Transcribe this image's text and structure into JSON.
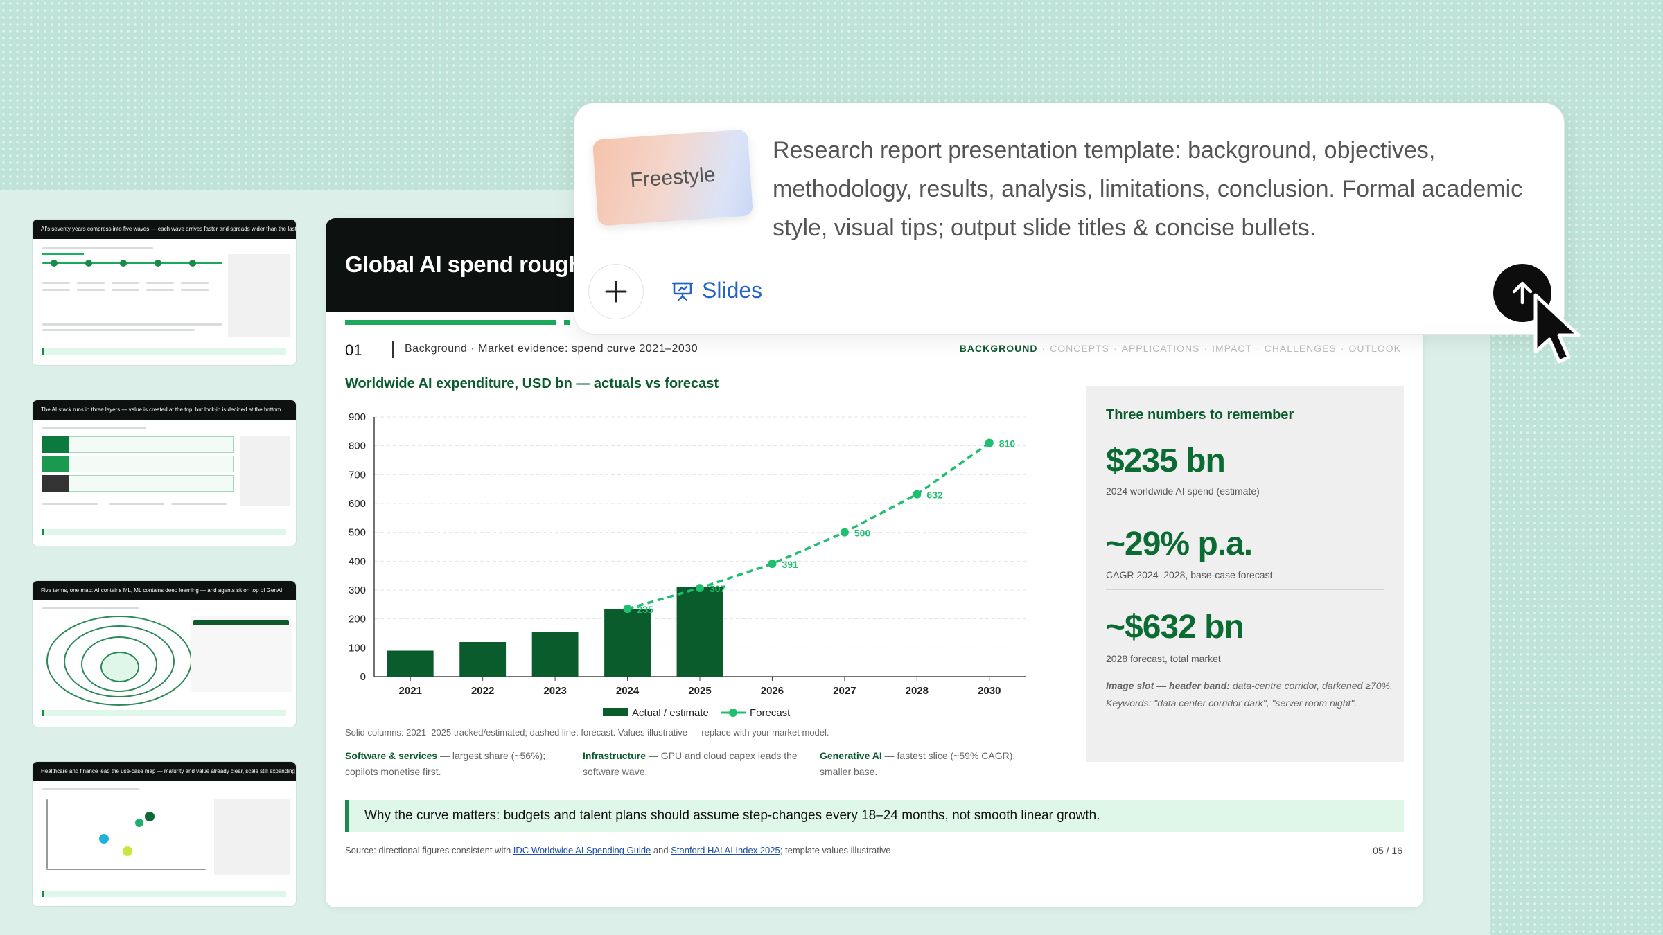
{
  "thumbnails": [
    {
      "title": "AI's seventy years compress into five waves — each wave arrives faster and spreads wider than the last"
    },
    {
      "title": "The AI stack runs in three layers — value is created at the top, but lock-in is decided at the bottom"
    },
    {
      "title": "Five terms, one map: AI contains ML, ML contains deep learning — and agents sit on top of GenAI"
    },
    {
      "title": "Healthcare and finance lead the use-case map — maturity and value already clear, scale still expanding"
    }
  ],
  "slide": {
    "header_title": "Global AI spend roughly",
    "section_number": "01",
    "breadcrumb": "Background · Market evidence: spend curve 2021–2030",
    "nav": [
      "BACKGROUND",
      "CONCEPTS",
      "APPLICATIONS",
      "IMPACT",
      "CHALLENGES",
      "OUTLOOK"
    ],
    "nav_active": "BACKGROUND",
    "chart_title": "Worldwide AI expenditure, USD bn — actuals vs forecast",
    "footnote": "Solid columns: 2021–2025 tracked/estimated; dashed line: forecast. Values illustrative — replace with your market model.",
    "columns": [
      {
        "head": "Software & services",
        "text": " — largest share (~56%); copilots monetise first."
      },
      {
        "head": "Infrastructure",
        "text": " — GPU and cloud capex leads the software wave."
      },
      {
        "head": "Generative AI",
        "text": " — fastest slice (~59% CAGR), smaller base."
      }
    ],
    "callout": "Why the curve matters: budgets and talent plans should assume step-changes every 18–24 months, not smooth linear growth.",
    "source": {
      "prefix": "Source: directional figures consistent with ",
      "link1": "IDC Worldwide AI Spending Guide",
      "mid": " and ",
      "link2": "Stanford HAI AI Index 2025",
      "suffix": "; template values illustrative"
    },
    "page": "05 / 16",
    "panel": {
      "title": "Three numbers to remember",
      "stats": [
        {
          "value": "$235 bn",
          "caption": "2024 worldwide AI spend (estimate)"
        },
        {
          "value": "~29% p.a.",
          "caption": "CAGR 2024–2028, base-case forecast"
        },
        {
          "value": "~$632 bn",
          "caption": "2028 forecast, total market"
        }
      ],
      "note_head": "Image slot — header band:",
      "note_text": " data-centre corridor, darkened ≥70%. Keywords: \"data center corridor dark\", \"server room night\"."
    }
  },
  "chart_data": {
    "type": "bar",
    "categories": [
      "2021",
      "2022",
      "2023",
      "2024",
      "2025",
      "2026",
      "2027",
      "2028",
      "2030"
    ],
    "series": [
      {
        "name": "Actual / estimate",
        "type": "bar",
        "values": [
          90,
          120,
          155,
          235,
          310,
          null,
          null,
          null,
          null
        ]
      },
      {
        "name": "Forecast",
        "type": "line",
        "values": [
          null,
          null,
          null,
          235,
          307,
          391,
          500,
          632,
          810
        ]
      }
    ],
    "data_labels": [
      "235",
      "307",
      "391",
      "500",
      "632",
      "810"
    ],
    "ylim": [
      0,
      900
    ],
    "yticks": [
      0,
      100,
      200,
      300,
      400,
      500,
      600,
      700,
      800,
      900
    ],
    "grid": true,
    "legend": "bottom",
    "colors": {
      "bar": "#0b5c2c",
      "line": "#1fbf6f"
    }
  },
  "prompt": {
    "style_chip": "Freestyle",
    "text": "Research report presentation template: background, objectives, methodology, results, analysis, limitations, conclusion. Formal academic style, visual tips; output slide titles & concise bullets.",
    "mode_label": "Slides",
    "icons": [
      "plus-icon",
      "presentation-icon",
      "arrow-up-icon",
      "cursor-icon"
    ]
  }
}
